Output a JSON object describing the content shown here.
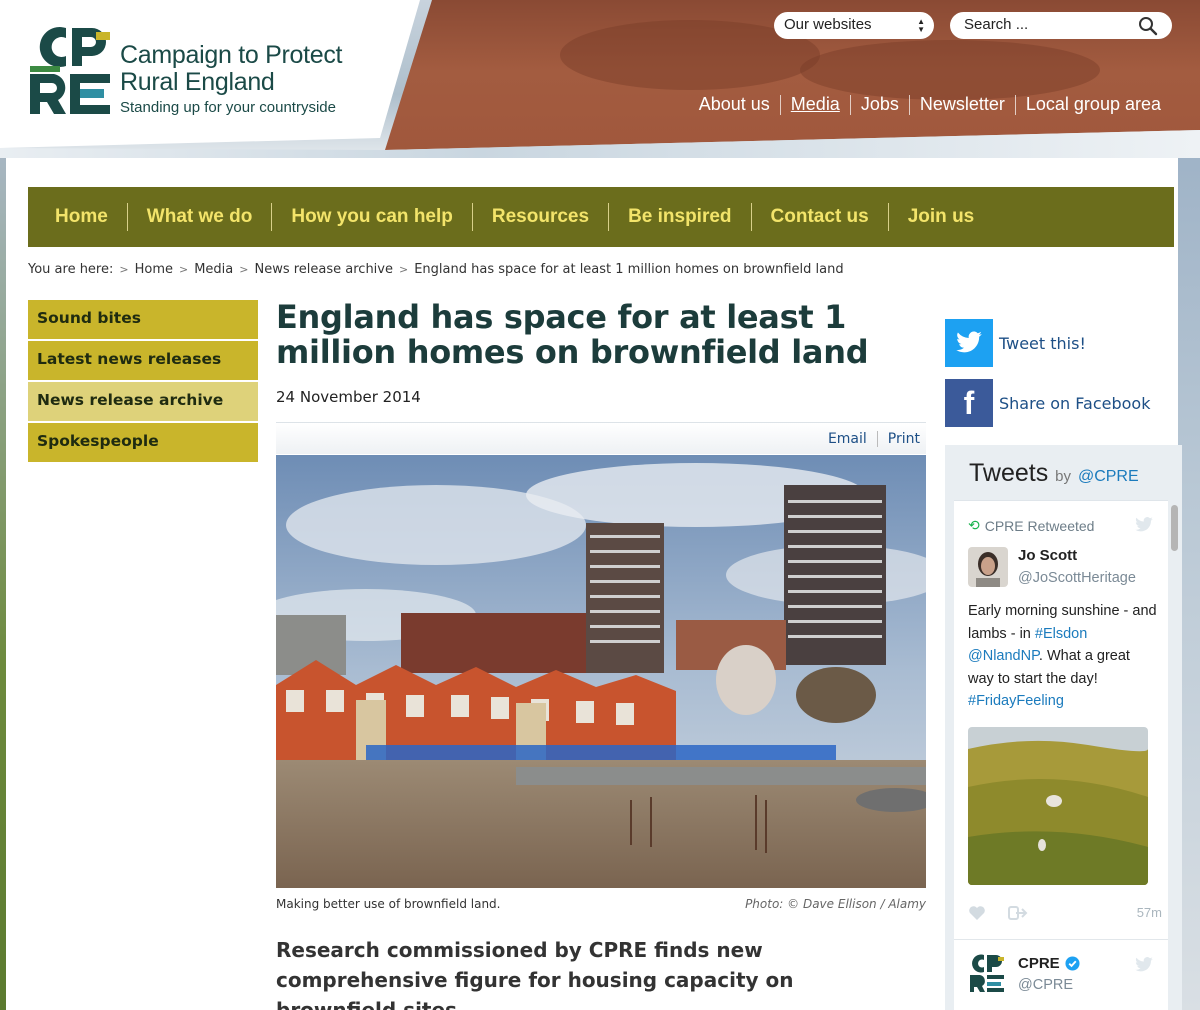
{
  "header": {
    "org_line1": "Campaign to Protect",
    "org_line2": "Rural England",
    "tagline": "Standing up for your countryside",
    "websites_select": "Our websites",
    "search_placeholder": "Search ...",
    "top_links": [
      "About us",
      "Media",
      "Jobs",
      "Newsletter",
      "Local group area"
    ],
    "active_top_link": "Media"
  },
  "nav": {
    "items": [
      "Home",
      "What we do",
      "How you can help",
      "Resources",
      "Be inspired",
      "Contact us",
      "Join us"
    ]
  },
  "breadcrumb": {
    "prefix": "You are here:",
    "items": [
      "Home",
      "Media",
      "News release archive",
      "England has space for at least 1 million homes on brownfield land"
    ]
  },
  "sidebar": {
    "items": [
      "Sound bites",
      "Latest news releases",
      "News release archive",
      "Spokespeople"
    ],
    "active": "News release archive"
  },
  "article": {
    "title": "England has space for at least 1 million homes on brownfield land",
    "date": "24 November 2014",
    "email_label": "Email",
    "print_label": "Print",
    "caption": "Making better use of brownfield land.",
    "credit": "Photo: © Dave Ellison / Alamy",
    "standfirst": "Research commissioned by CPRE finds new comprehensive figure for housing capacity on brownfield sites."
  },
  "social": {
    "tweet_label": "Tweet this!",
    "facebook_label": "Share on Facebook"
  },
  "tweets": {
    "title": "Tweets",
    "by": "by",
    "handle": "@CPRE",
    "retweet_label": "CPRE Retweeted",
    "tweet1": {
      "name": "Jo Scott",
      "user": "@JoScottHeritage",
      "text_a": "Early morning sunshine - and lambs - in ",
      "tag1": "#Elsdon",
      "mention": "@NlandNP",
      "text_b": ". What a great way to start the day! ",
      "tag2": "#FridayFeeling",
      "time": "57m"
    },
    "tweet2": {
      "name": "CPRE",
      "user": "@CPRE"
    }
  },
  "colors": {
    "nav_bg": "#6b6d1c",
    "nav_text": "#f3e46a",
    "sidebar_bg": "#c9b52b",
    "sidebar_active": "#ded27a",
    "title": "#1c3c3b",
    "link": "#1d4f86",
    "twitter_blue": "#1da1f2",
    "facebook_blue": "#3b5a9a"
  }
}
